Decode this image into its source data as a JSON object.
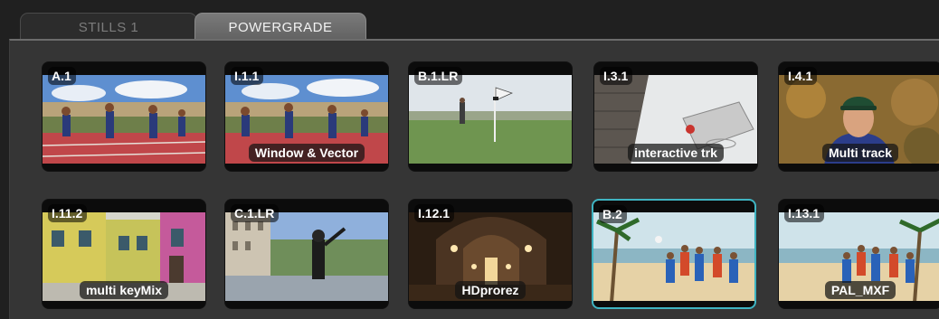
{
  "tabs": [
    {
      "label": "STILLS 1",
      "active": false
    },
    {
      "label": "POWERGRADE",
      "active": true
    }
  ],
  "gallery": {
    "stills": [
      {
        "id": "A.1",
        "label": "",
        "thumb": "runners-track-icon"
      },
      {
        "id": "I.1.1",
        "label": "Window & Vector",
        "thumb": "runners-track-icon"
      },
      {
        "id": "B.1.LR",
        "label": "",
        "thumb": "golf-green-icon"
      },
      {
        "id": "I.3.1",
        "label": "interactive trk",
        "thumb": "basketball-hoop-icon"
      },
      {
        "id": "I.4.1",
        "label": "Multi track",
        "thumb": "portrait-cap-icon"
      },
      {
        "id": "I.11.2",
        "label": "multi keyMix",
        "thumb": "colorful-street-icon"
      },
      {
        "id": "C.1.LR",
        "label": "",
        "thumb": "plaza-skater-icon"
      },
      {
        "id": "I.12.1",
        "label": "HDprorez",
        "thumb": "cathedral-interior-icon"
      },
      {
        "id": "B.2",
        "label": "",
        "thumb": "beach-volleyball-icon",
        "selected": true
      },
      {
        "id": "I.13.1",
        "label": "PAL_MXF",
        "thumb": "beach-volleyball-icon"
      }
    ]
  },
  "colors": {
    "selection": "#3fb4c2",
    "active_tab": "#6e6e6e",
    "panel": "#353535"
  }
}
